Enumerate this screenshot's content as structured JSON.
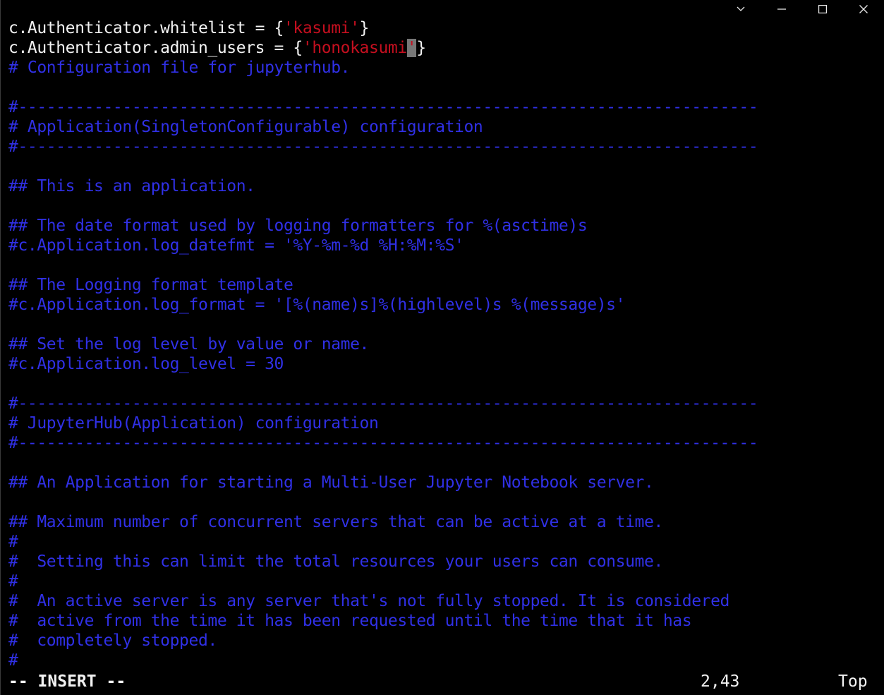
{
  "window_controls": {
    "menu_icon": "chevron-down-icon",
    "minimize_icon": "minimize-icon",
    "maximize_icon": "maximize-icon",
    "close_icon": "close-icon"
  },
  "colors": {
    "background": "#000000",
    "code_text": "#f2f2f2",
    "string": "#c50f1f",
    "comment": "#3030e6",
    "cursor": "#777777"
  },
  "editor": {
    "line1": {
      "prefix": "c.Authenticator.whitelist = {",
      "string": "'kasumi'",
      "suffix": "}"
    },
    "line2": {
      "prefix": "c.Authenticator.admin_users = {",
      "string": "'honokasumi",
      "cursor_char": "'",
      "suffix": "}"
    },
    "comment_lines": [
      "# Configuration file for jupyterhub.",
      "",
      "#------------------------------------------------------------------------------",
      "# Application(SingletonConfigurable) configuration",
      "#------------------------------------------------------------------------------",
      "",
      "## This is an application.",
      "",
      "## The date format used by logging formatters for %(asctime)s",
      "#c.Application.log_datefmt = '%Y-%m-%d %H:%M:%S'",
      "",
      "## The Logging format template",
      "#c.Application.log_format = '[%(name)s]%(highlevel)s %(message)s'",
      "",
      "## Set the log level by value or name.",
      "#c.Application.log_level = 30",
      "",
      "#------------------------------------------------------------------------------",
      "# JupyterHub(Application) configuration",
      "#------------------------------------------------------------------------------",
      "",
      "## An Application for starting a Multi-User Jupyter Notebook server.",
      "",
      "## Maximum number of concurrent servers that can be active at a time.",
      "#",
      "#  Setting this can limit the total resources your users can consume.",
      "#",
      "#  An active server is any server that's not fully stopped. It is considered",
      "#  active from the time it has been requested until the time that it has",
      "#  completely stopped.",
      "#"
    ]
  },
  "status": {
    "mode": "-- INSERT --",
    "position": "2,43",
    "scroll": "Top"
  }
}
